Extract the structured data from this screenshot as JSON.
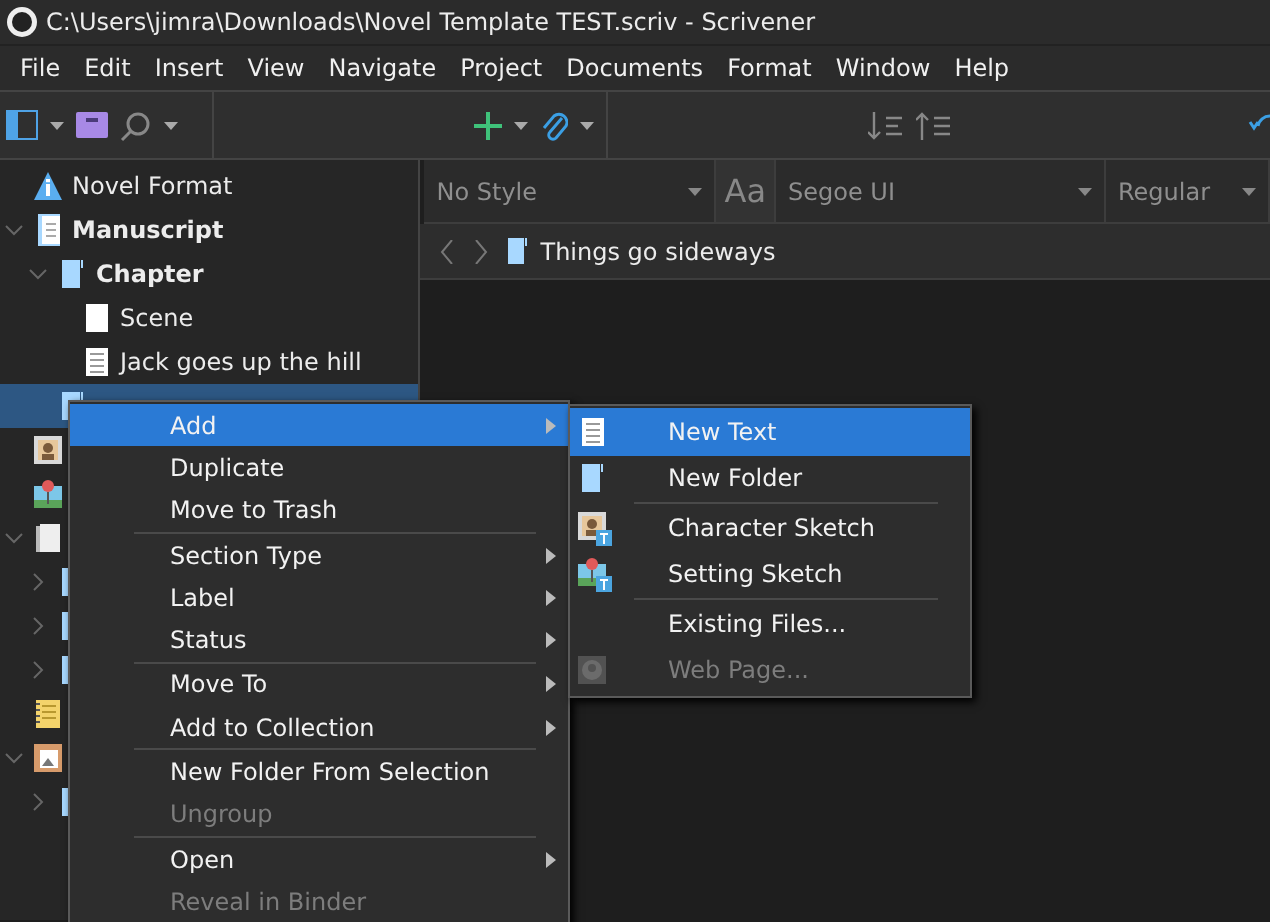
{
  "window": {
    "title": "C:\\Users\\jimra\\Downloads\\Novel Template TEST.scriv - Scrivener"
  },
  "menu_bar": [
    "File",
    "Edit",
    "Insert",
    "View",
    "Navigate",
    "Project",
    "Documents",
    "Format",
    "Window",
    "Help"
  ],
  "format_bar": {
    "style": "No Style",
    "font_icon": "Aa",
    "font": "Segoe UI",
    "weight": "Regular"
  },
  "header_bar": {
    "document": "Things go sideways"
  },
  "binder": [
    {
      "kind": "info",
      "label": "Novel Format",
      "bold": false,
      "chevron": false,
      "selected": false
    },
    {
      "kind": "text-stack",
      "label": "Manuscript",
      "bold": true,
      "chevron": true,
      "selected": false,
      "children": [
        {
          "kind": "folder",
          "label": "Chapter",
          "bold": true,
          "chevron": true,
          "selected": false,
          "children": [
            {
              "kind": "blank",
              "label": "Scene",
              "bold": false,
              "chevron": false,
              "selected": false
            },
            {
              "kind": "text",
              "label": "Jack goes up the hill",
              "bold": false,
              "chevron": false,
              "selected": false
            }
          ]
        },
        {
          "kind": "folder",
          "bold": true,
          "chevron": false,
          "selected": true
        }
      ]
    },
    {
      "kind": "character",
      "chevron": false,
      "selected": false
    },
    {
      "kind": "place",
      "chevron": false,
      "selected": false
    },
    {
      "kind": "research",
      "chevron": true,
      "selected": false,
      "children": [
        {
          "kind": "folder",
          "chevron": true,
          "selected": false
        },
        {
          "kind": "folder",
          "chevron": true,
          "selected": false
        },
        {
          "kind": "folder",
          "chevron": true,
          "selected": false
        }
      ]
    },
    {
      "kind": "notes",
      "chevron": false,
      "selected": false
    },
    {
      "kind": "picture-folder",
      "chevron": true,
      "selected": false,
      "children": [
        {
          "kind": "folder",
          "chevron": true,
          "selected": false
        }
      ]
    }
  ],
  "context_menu": [
    {
      "kind": "item",
      "label": "Add",
      "submenu": true,
      "disabled": false,
      "selected": true
    },
    {
      "kind": "item",
      "label": "Duplicate",
      "submenu": false,
      "disabled": false,
      "selected": false
    },
    {
      "kind": "item",
      "label": "Move to Trash",
      "submenu": false,
      "disabled": false,
      "selected": false
    },
    {
      "kind": "separator"
    },
    {
      "kind": "item",
      "label": "Section Type",
      "submenu": true,
      "disabled": false,
      "selected": false
    },
    {
      "kind": "item",
      "label": "Label",
      "submenu": true,
      "disabled": false,
      "selected": false
    },
    {
      "kind": "item",
      "label": "Status",
      "submenu": true,
      "disabled": false,
      "selected": false
    },
    {
      "kind": "separator"
    },
    {
      "kind": "item",
      "label": "Move To",
      "submenu": true,
      "disabled": false,
      "selected": false
    },
    {
      "kind": "item",
      "label": "Add to Collection",
      "submenu": true,
      "disabled": false,
      "selected": false
    },
    {
      "kind": "separator"
    },
    {
      "kind": "item",
      "label": "New Folder From Selection",
      "submenu": false,
      "disabled": false,
      "selected": false
    },
    {
      "kind": "item",
      "label": "Ungroup",
      "submenu": false,
      "disabled": true,
      "selected": false
    },
    {
      "kind": "separator"
    },
    {
      "kind": "item",
      "label": "Open",
      "submenu": true,
      "disabled": false,
      "selected": false
    },
    {
      "kind": "item",
      "label": "Reveal in Binder",
      "submenu": false,
      "disabled": true,
      "selected": false
    }
  ],
  "add_submenu": [
    {
      "kind": "text",
      "label": "New Text",
      "disabled": false,
      "selected": true
    },
    {
      "kind": "folder",
      "label": "New Folder",
      "disabled": false,
      "selected": false
    },
    {
      "kind": "separator"
    },
    {
      "kind": "character",
      "label": "Character Sketch",
      "disabled": false,
      "selected": false
    },
    {
      "kind": "place",
      "label": "Setting Sketch",
      "disabled": false,
      "selected": false
    },
    {
      "kind": "separator"
    },
    {
      "kind": "plain",
      "label": "Existing Files...",
      "disabled": false,
      "selected": false
    },
    {
      "kind": "web",
      "label": "Web Page...",
      "disabled": true,
      "selected": false
    }
  ]
}
